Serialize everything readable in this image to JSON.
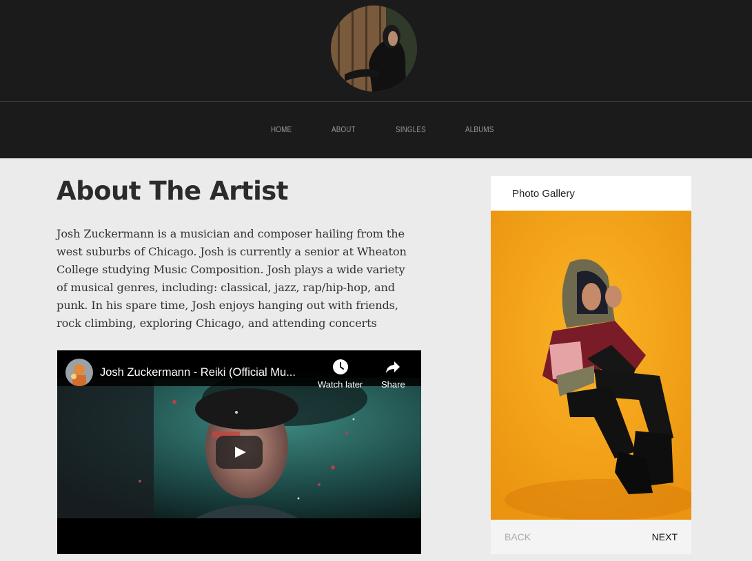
{
  "nav": {
    "items": [
      {
        "label": "HOME"
      },
      {
        "label": "ABOUT"
      },
      {
        "label": "SINGLES"
      },
      {
        "label": "ALBUMS"
      }
    ]
  },
  "about": {
    "title": "About The Artist",
    "bio": "Josh Zuckermann is a musician and composer hailing from the west suburbs of Chicago. Josh is currently a senior at Wheaton College studying Music Composition. Josh plays a wide variety of musical genres, including: classical, jazz, rap/hip-hop, and punk. In his spare time, Josh enjoys hanging out with friends, rock climbing, exploring Chicago, and attending concerts"
  },
  "video": {
    "title": "Josh Zuckermann - Reiki (Official Mu...",
    "watch_later": "Watch later",
    "share": "Share"
  },
  "gallery": {
    "title": "Photo Gallery",
    "back": "BACK",
    "next": "NEXT"
  },
  "colors": {
    "header_bg": "#1b1b1b",
    "page_bg": "#ebebeb",
    "gallery_photo_bg": "#f4a71a"
  }
}
